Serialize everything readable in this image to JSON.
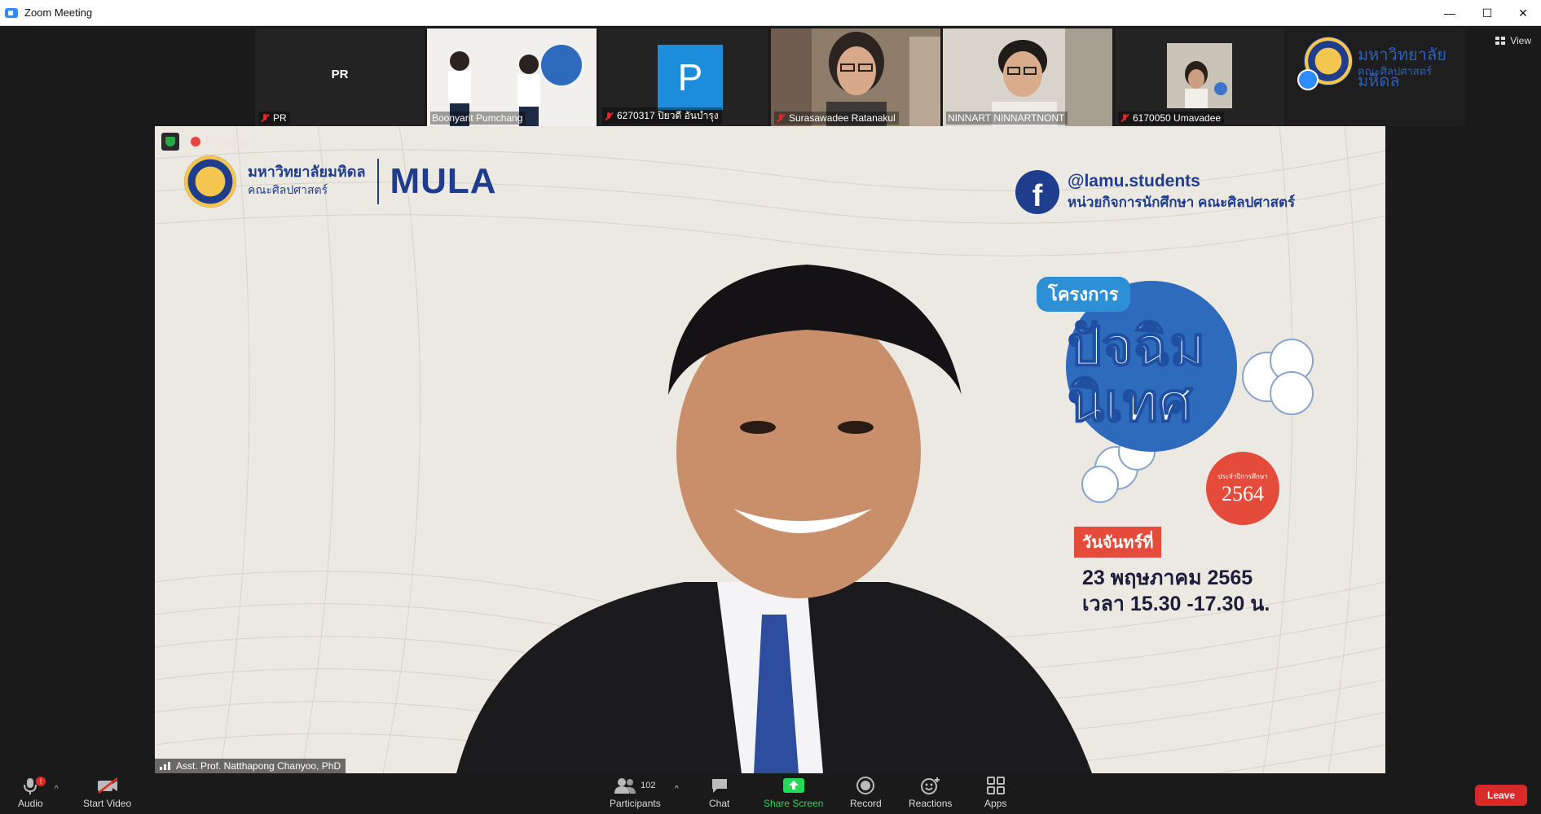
{
  "window": {
    "title": "Zoom Meeting",
    "minimize": "—",
    "maximize": "☐",
    "close": "✕"
  },
  "gallery": {
    "tiles": [
      {
        "name": "PR",
        "initials": "PR",
        "muted": true,
        "kind": "initials"
      },
      {
        "name": "Boonyarit Pumchang",
        "muted": false,
        "kind": "video"
      },
      {
        "name": "6270317 ปิยวดี อันบำรุง",
        "initials": "P",
        "muted": true,
        "kind": "avatar"
      },
      {
        "name": "Surasawadee Ratanakul",
        "muted": true,
        "kind": "video"
      },
      {
        "name": "NINNART NINNARTNONT",
        "muted": false,
        "kind": "video"
      },
      {
        "name": "6170050 Umavadee",
        "muted": true,
        "kind": "video"
      }
    ],
    "selfview": {
      "uni_name": "มหาวิทยาลัยมหิดล",
      "faculty": "คณะศิลปศาสตร์"
    },
    "view_button": "View"
  },
  "main_video": {
    "recording_label": "Recording",
    "speaker_name": "Asst. Prof. Natthapong Chanyoo, PhD",
    "slide": {
      "uni_name": "มหาวิทยาลัยมหิดล",
      "faculty": "คณะศิลปศาสตร์",
      "brand": "MULA",
      "fb_handle": "@lamu.students",
      "fb_unit": "หน่วยกิจการนักศึกษา คณะศิลปศาสตร์",
      "project_tag": "โครงการ",
      "project_title": "ปัจฉิมนิเทศ",
      "badge_small": "ประจำปีการศึกษา",
      "badge_year": "2564",
      "day_label": "วันจันทร์ที่",
      "date": "23 พฤษภาคม 2565",
      "time": "เวลา 15.30 -17.30 น."
    }
  },
  "toolbar": {
    "audio": "Audio",
    "audio_badge": "!",
    "start_video": "Start Video",
    "participants": "Participants",
    "participants_count": "102",
    "chat": "Chat",
    "share_screen": "Share Screen",
    "record": "Record",
    "reactions": "Reactions",
    "apps": "Apps",
    "leave": "Leave"
  },
  "colors": {
    "accent": "#2d8cff",
    "share_green": "#23d959",
    "leave_red": "#d92a2a",
    "slide_blue": "#1f3d8c"
  }
}
